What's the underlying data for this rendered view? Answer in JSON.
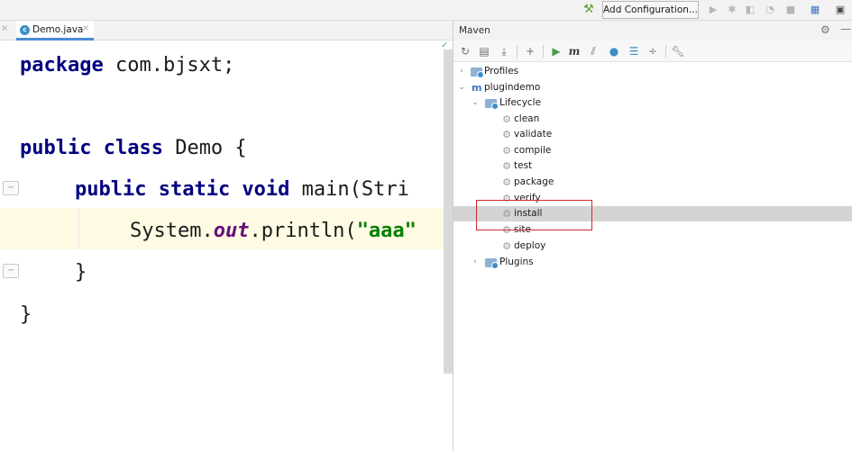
{
  "toolbar": {
    "hammer_icon": "hammer-icon",
    "add_configuration_label": "Add Configuration...",
    "icons": [
      "run-icon",
      "debug-icon",
      "coverage-icon",
      "profile-icon",
      "stop-icon",
      "project-structure-icon",
      "terminal-icon"
    ]
  },
  "editor": {
    "tab": {
      "label": "Demo.java",
      "close_glyph": "×",
      "icon": "java-class-icon"
    },
    "left_tab_close_glyph": "×",
    "check_glyph": "✓",
    "code": {
      "line1_kw": "package",
      "line1_rest": " com.bjsxt;",
      "line2_kw": "public class",
      "line2_rest": " Demo {",
      "line3_kw": "public static void",
      "line3_rest": " main(Stri",
      "line4_a": "System.",
      "line4_out": "out",
      "line4_b": ".println(",
      "line4_str": "\"aaa\"",
      "line5": "}",
      "line6": "}"
    }
  },
  "maven": {
    "title": "Maven",
    "settings_glyph": "⚙",
    "hide_glyph": "—",
    "tree": {
      "profiles": "Profiles",
      "project": "plugindemo",
      "lifecycle": "Lifecycle",
      "phases": [
        "clean",
        "validate",
        "compile",
        "test",
        "package",
        "verify",
        "install",
        "site",
        "deploy"
      ],
      "plugins": "Plugins",
      "selected_phase": "install"
    }
  },
  "colors": {
    "keyword": "#000080",
    "string": "#008000",
    "static_field": "#660e7a",
    "highlight_line": "#fffae3",
    "selection_box": "#d12a2a",
    "selected_row": "#d4d4d4"
  }
}
